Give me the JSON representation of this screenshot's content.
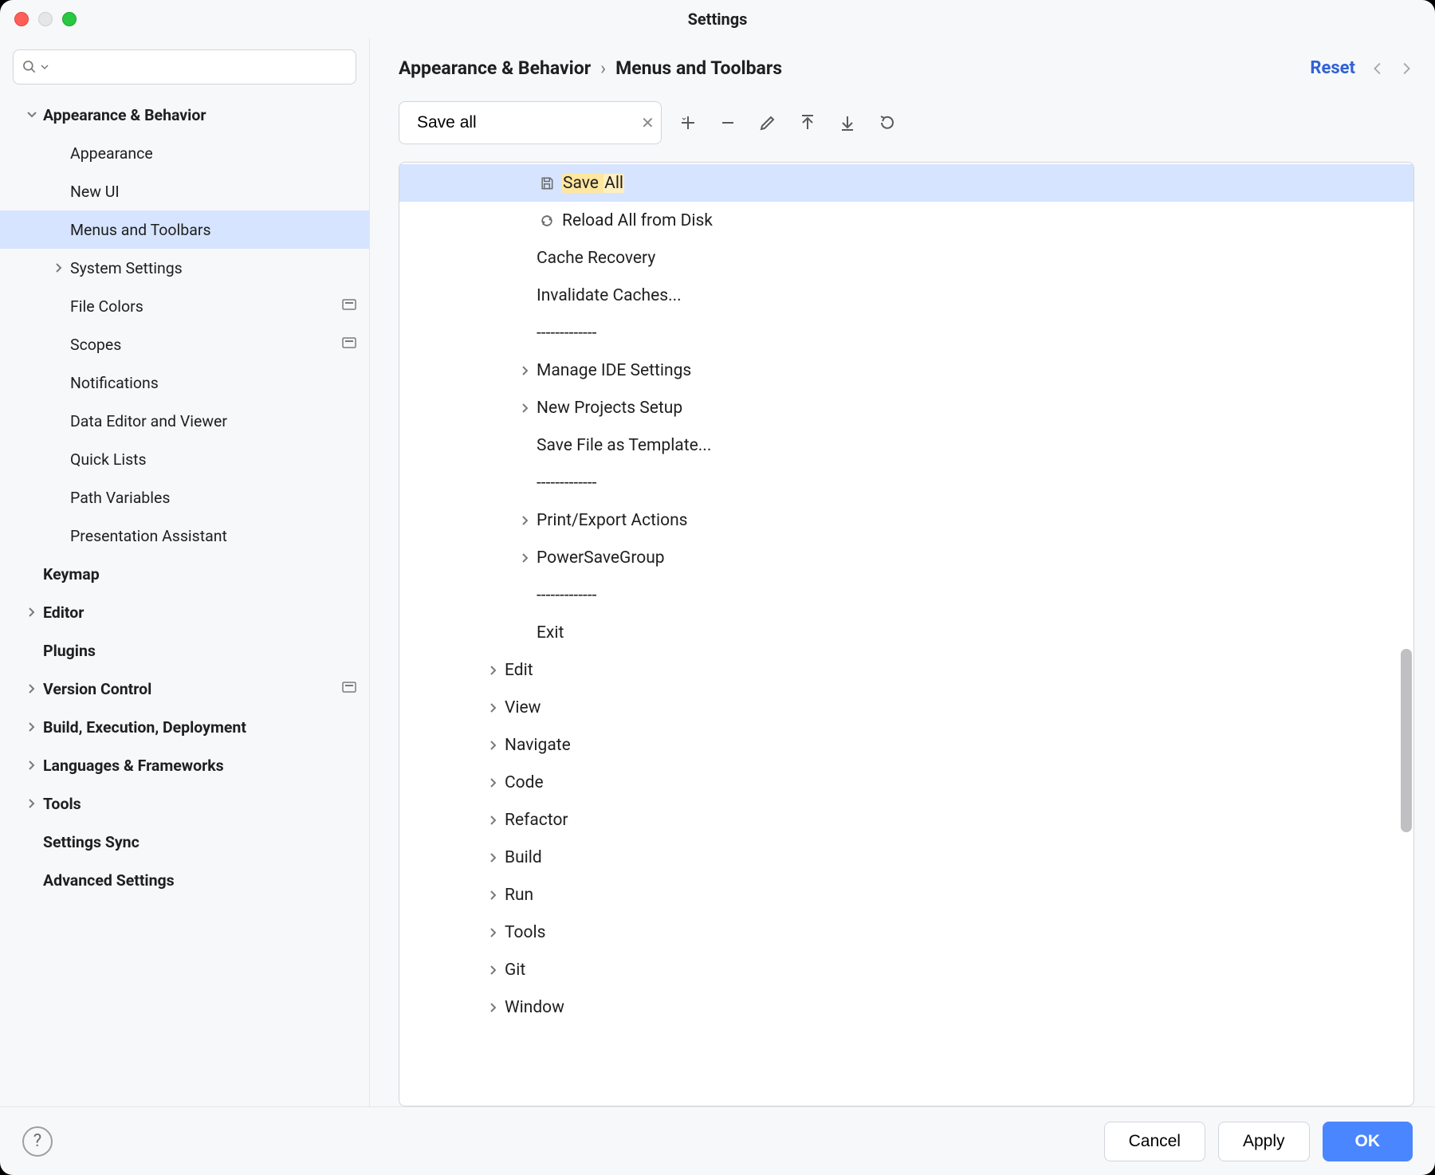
{
  "window_title": "Settings",
  "sidebar": {
    "search_value": "",
    "items": [
      {
        "label": "Appearance & Behavior",
        "bold": true,
        "chevron": "down",
        "indent": 0,
        "badge": false
      },
      {
        "label": "Appearance",
        "bold": false,
        "chevron": "",
        "indent": 1,
        "badge": false
      },
      {
        "label": "New UI",
        "bold": false,
        "chevron": "",
        "indent": 1,
        "badge": false
      },
      {
        "label": "Menus and Toolbars",
        "bold": false,
        "chevron": "",
        "indent": 1,
        "badge": false,
        "selected": true
      },
      {
        "label": "System Settings",
        "bold": false,
        "chevron": "right",
        "indent": 1,
        "badge": false
      },
      {
        "label": "File Colors",
        "bold": false,
        "chevron": "",
        "indent": 1,
        "badge": true
      },
      {
        "label": "Scopes",
        "bold": false,
        "chevron": "",
        "indent": 1,
        "badge": true
      },
      {
        "label": "Notifications",
        "bold": false,
        "chevron": "",
        "indent": 1,
        "badge": false
      },
      {
        "label": "Data Editor and Viewer",
        "bold": false,
        "chevron": "",
        "indent": 1,
        "badge": false
      },
      {
        "label": "Quick Lists",
        "bold": false,
        "chevron": "",
        "indent": 1,
        "badge": false
      },
      {
        "label": "Path Variables",
        "bold": false,
        "chevron": "",
        "indent": 1,
        "badge": false
      },
      {
        "label": "Presentation Assistant",
        "bold": false,
        "chevron": "",
        "indent": 1,
        "badge": false
      },
      {
        "label": "Keymap",
        "bold": true,
        "chevron": "",
        "indent": 0,
        "badge": false
      },
      {
        "label": "Editor",
        "bold": true,
        "chevron": "right",
        "indent": 0,
        "badge": false
      },
      {
        "label": "Plugins",
        "bold": true,
        "chevron": "",
        "indent": 0,
        "badge": false
      },
      {
        "label": "Version Control",
        "bold": true,
        "chevron": "right",
        "indent": 0,
        "badge": true
      },
      {
        "label": "Build, Execution, Deployment",
        "bold": true,
        "chevron": "right",
        "indent": 0,
        "badge": false
      },
      {
        "label": "Languages & Frameworks",
        "bold": true,
        "chevron": "right",
        "indent": 0,
        "badge": false
      },
      {
        "label": "Tools",
        "bold": true,
        "chevron": "right",
        "indent": 0,
        "badge": false
      },
      {
        "label": "Settings Sync",
        "bold": true,
        "chevron": "",
        "indent": 0,
        "badge": false
      },
      {
        "label": "Advanced Settings",
        "bold": true,
        "chevron": "",
        "indent": 0,
        "badge": false
      }
    ]
  },
  "breadcrumb": {
    "part1": "Appearance & Behavior",
    "part2": "Menus and Toolbars"
  },
  "reset_label": "Reset",
  "action_search_value": "Save all",
  "tree": {
    "items": [
      {
        "label": "Save All",
        "indent": 4,
        "chevron": "",
        "icon": "save",
        "selected": true,
        "highlight": true
      },
      {
        "label": "Reload All from Disk",
        "indent": 4,
        "chevron": "",
        "icon": "reload"
      },
      {
        "label": "Cache Recovery",
        "indent": 4,
        "chevron": "",
        "icon": ""
      },
      {
        "label": "Invalidate Caches...",
        "indent": 4,
        "chevron": "",
        "icon": ""
      },
      {
        "label": "-------------",
        "indent": 4,
        "chevron": "",
        "icon": "",
        "sep": true
      },
      {
        "label": "Manage IDE Settings",
        "indent": 4,
        "chevron": "right",
        "icon": ""
      },
      {
        "label": "New Projects Setup",
        "indent": 4,
        "chevron": "right",
        "icon": ""
      },
      {
        "label": "Save File as Template...",
        "indent": 4,
        "chevron": "",
        "icon": ""
      },
      {
        "label": "-------------",
        "indent": 4,
        "chevron": "",
        "icon": "",
        "sep": true
      },
      {
        "label": "Print/Export Actions",
        "indent": 4,
        "chevron": "right",
        "icon": ""
      },
      {
        "label": "PowerSaveGroup",
        "indent": 4,
        "chevron": "right",
        "icon": ""
      },
      {
        "label": "-------------",
        "indent": 4,
        "chevron": "",
        "icon": "",
        "sep": true
      },
      {
        "label": "Exit",
        "indent": 4,
        "chevron": "",
        "icon": ""
      },
      {
        "label": "Edit",
        "indent": 3,
        "chevron": "right",
        "icon": ""
      },
      {
        "label": "View",
        "indent": 3,
        "chevron": "right",
        "icon": ""
      },
      {
        "label": "Navigate",
        "indent": 3,
        "chevron": "right",
        "icon": ""
      },
      {
        "label": "Code",
        "indent": 3,
        "chevron": "right",
        "icon": ""
      },
      {
        "label": "Refactor",
        "indent": 3,
        "chevron": "right",
        "icon": ""
      },
      {
        "label": "Build",
        "indent": 3,
        "chevron": "right",
        "icon": ""
      },
      {
        "label": "Run",
        "indent": 3,
        "chevron": "right",
        "icon": ""
      },
      {
        "label": "Tools",
        "indent": 3,
        "chevron": "right",
        "icon": ""
      },
      {
        "label": "Git",
        "indent": 3,
        "chevron": "right",
        "icon": ""
      },
      {
        "label": "Window",
        "indent": 3,
        "chevron": "right",
        "icon": ""
      }
    ]
  },
  "footer": {
    "help": "?",
    "cancel": "Cancel",
    "apply": "Apply",
    "ok": "OK"
  }
}
